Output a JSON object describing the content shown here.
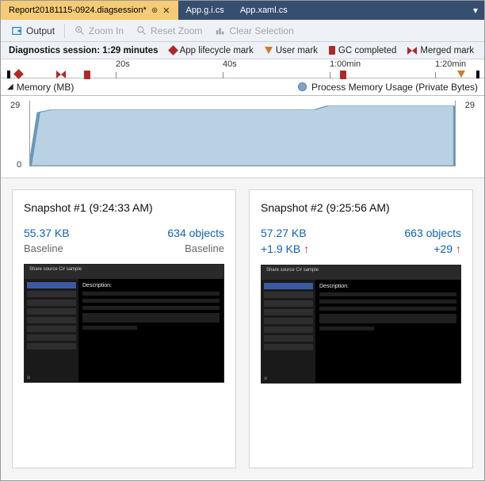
{
  "tabs": [
    {
      "label": "Report20181115-0924.diagsession*",
      "active": true
    },
    {
      "label": "App.g.i.cs",
      "active": false
    },
    {
      "label": "App.xaml.cs",
      "active": false
    }
  ],
  "toolbar": {
    "output": "Output",
    "zoom_in": "Zoom In",
    "reset_zoom": "Reset Zoom",
    "clear_selection": "Clear Selection"
  },
  "status": {
    "session_label": "Diagnostics session:",
    "session_value": "1:29 minutes",
    "lifecycle": "App lifecycle mark",
    "user": "User mark",
    "gc": "GC completed",
    "merged": "Merged mark"
  },
  "ruler": {
    "ticks": [
      "20s",
      "40s",
      "1:00min",
      "1:20min"
    ]
  },
  "memory": {
    "title": "Memory (MB)",
    "legend": "Process Memory Usage (Private Bytes)"
  },
  "chart_data": {
    "type": "area",
    "title": "Memory (MB)",
    "xlabel": "",
    "ylabel": "MB",
    "ylim": [
      0,
      29
    ],
    "x": [
      0,
      2,
      4,
      60,
      62,
      89
    ],
    "values": [
      0,
      24,
      25,
      25,
      27,
      27
    ],
    "y_tick_left": "29",
    "y_tick_right": "29",
    "y_zero": "0"
  },
  "snapshots": [
    {
      "title": "Snapshot #1  (9:24:33 AM)",
      "size": "55.37 KB",
      "objects": "634 objects",
      "sub_left": "Baseline",
      "sub_right": "Baseline",
      "delta_size": "",
      "delta_obj": "",
      "app_title": "Share source C# sample",
      "desc": "Description:"
    },
    {
      "title": "Snapshot #2  (9:25:56 AM)",
      "size": "57.27 KB",
      "objects": "663 objects",
      "sub_left": "",
      "sub_right": "",
      "delta_size": "+1.9 KB",
      "delta_obj": "+29",
      "app_title": "Share source C# sample",
      "desc": "Description:"
    }
  ]
}
